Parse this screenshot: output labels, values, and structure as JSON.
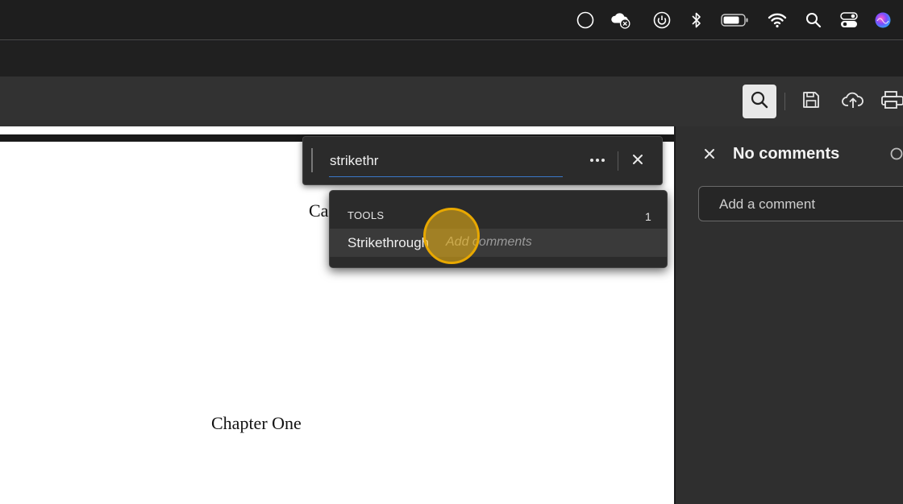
{
  "menubar": {
    "icons": [
      "record-circle-icon",
      "cloud-offline-icon",
      "power-icon",
      "bluetooth-icon",
      "battery-icon",
      "wifi-icon",
      "spotlight-search-icon",
      "control-center-icon",
      "siri-icon"
    ]
  },
  "toolbar": {
    "buttons": [
      "search-icon",
      "save-icon",
      "cloud-upload-icon",
      "print-icon"
    ]
  },
  "document": {
    "partial_text": "Ca",
    "chapter_heading": "Chapter One"
  },
  "comments_panel": {
    "title": "No comments",
    "comment_placeholder": "Add a comment"
  },
  "find": {
    "query": "strikethr",
    "section_label": "TOOLS",
    "section_count": "1",
    "result_name": "Strikethrough",
    "result_hint": "Add comments"
  },
  "colors": {
    "accent_underline": "#3a78c9",
    "click_highlight": "#f5b914"
  }
}
